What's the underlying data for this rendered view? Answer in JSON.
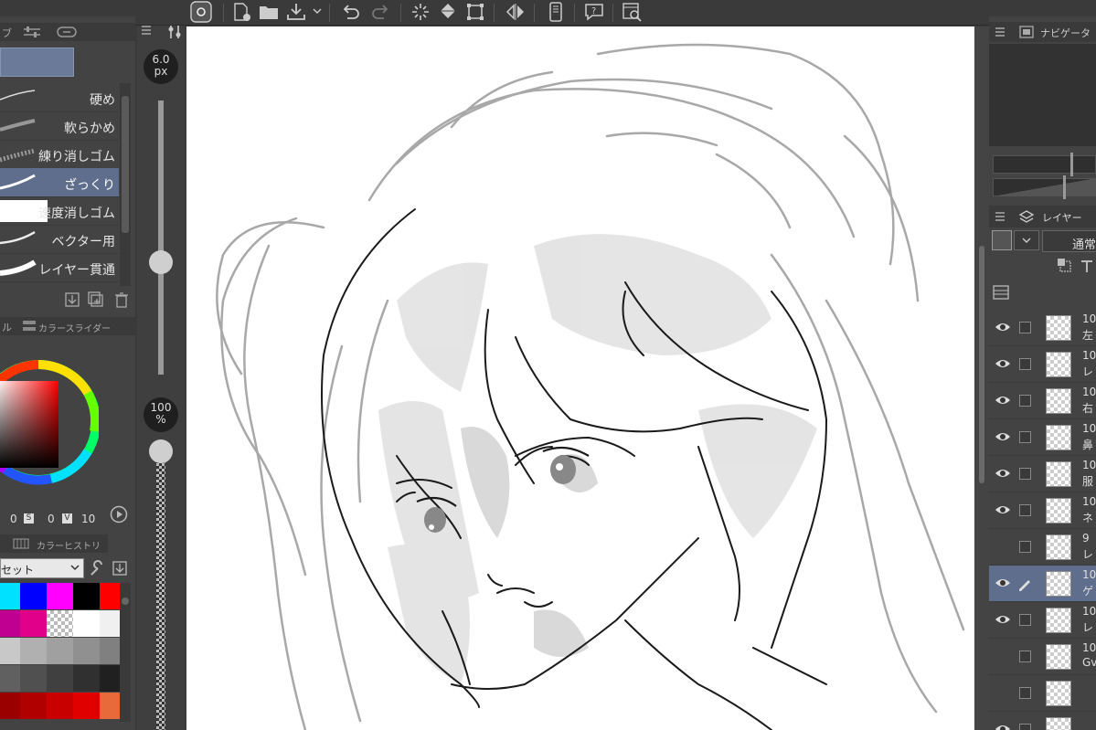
{
  "left_panel": {
    "tab_partial": "ブ",
    "brushes": [
      {
        "label": "硬め"
      },
      {
        "label": "軟らかめ"
      },
      {
        "label": "練り消しゴム"
      },
      {
        "label": "ざっくり",
        "selected": true
      },
      {
        "label": "速度消しゴム"
      },
      {
        "label": "ベクター用"
      },
      {
        "label": "レイヤー貫通"
      }
    ],
    "color_tabs": {
      "partial": "ル",
      "slider_tab": "カラースライダー"
    },
    "hsv": {
      "h": "0",
      "s_label": "S",
      "s": "0",
      "v_label": "V",
      "v": "10"
    },
    "history_tab": "カラーヒストリー",
    "palette_select": "セット",
    "swatches": [
      [
        "#00e0ff",
        "#0000ff",
        "#ff00ff",
        "#000000",
        "#ff0000"
      ],
      [
        "#c00090",
        "#e0008a",
        "checker",
        "#ffffff",
        "#f0f0f0"
      ],
      [
        "#c8c8c8",
        "#b0b0b0",
        "#a0a0a0",
        "#909090",
        "#808080"
      ],
      [
        "#606060",
        "#505050",
        "#404040",
        "#303030",
        "#202020"
      ],
      [
        "#9a0000",
        "#b00000",
        "#c80000",
        "#e00000",
        "#e86a3a"
      ]
    ]
  },
  "sliders": {
    "size_value": "6.0",
    "size_unit": "px",
    "opacity_value": "100",
    "opacity_unit": "%"
  },
  "right_panel": {
    "navigator_tab": "ナビゲーター",
    "layer_tab": "レイヤー",
    "blend_mode": "通常",
    "layers": [
      {
        "line1": "10",
        "line2": "左",
        "visible": true
      },
      {
        "line1": "10",
        "line2": "レ",
        "visible": true
      },
      {
        "line1": "10",
        "line2": "右",
        "visible": true
      },
      {
        "line1": "10",
        "line2": "鼻",
        "visible": true
      },
      {
        "line1": "10",
        "line2": "服",
        "visible": true
      },
      {
        "line1": "10",
        "line2": "ネ",
        "visible": true
      },
      {
        "line1": "9",
        "line2": "レ",
        "visible": false
      },
      {
        "line1": "10",
        "line2": "ゲ",
        "visible": true,
        "selected": true,
        "editing": true
      },
      {
        "line1": "10",
        "line2": "レ",
        "visible": true
      },
      {
        "line1": "10",
        "line2": "Gv",
        "visible": false
      },
      {
        "line1": "",
        "line2": "",
        "visible": false
      },
      {
        "line1": "",
        "line2": "",
        "visible": true
      }
    ]
  },
  "colors": {
    "accent": "#5f6e8c",
    "panel": "#434343",
    "toolbar": "#3a3a3a"
  }
}
